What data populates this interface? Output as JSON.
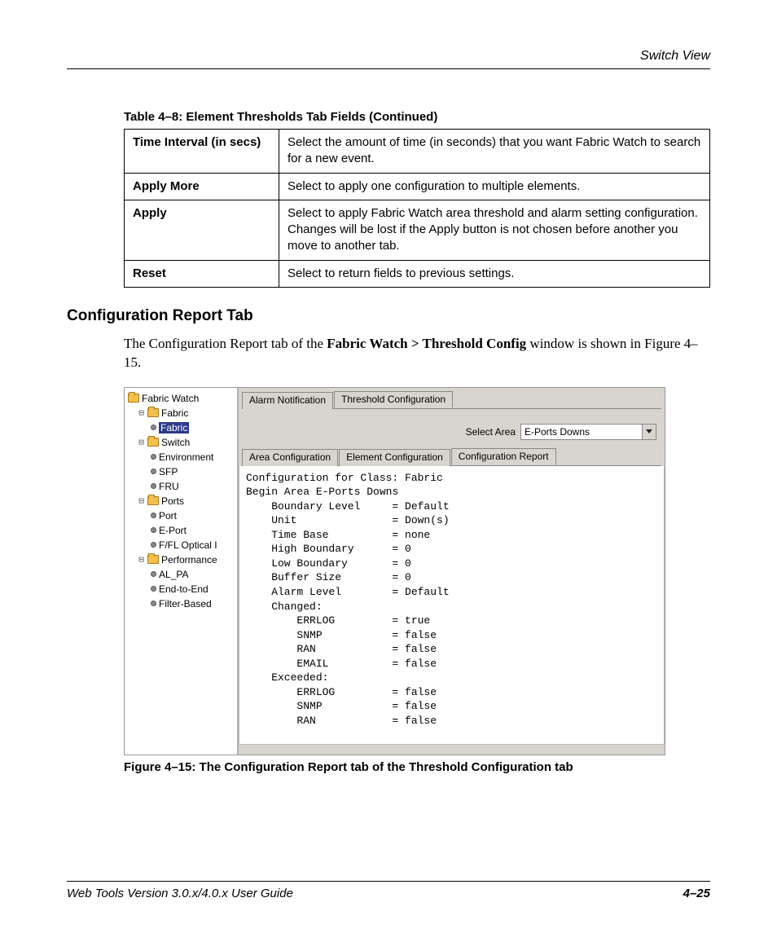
{
  "header": {
    "section": "Switch View"
  },
  "table": {
    "caption": "Table 4–8:  Element Thresholds Tab Fields (Continued)",
    "rows": [
      {
        "field": "Time Interval (in secs)",
        "desc": "Select the amount of time (in seconds) that you want Fabric Watch to search for a new event."
      },
      {
        "field": "Apply More",
        "desc": "Select to apply one configuration to multiple elements."
      },
      {
        "field": "Apply",
        "desc": "Select to apply Fabric Watch area threshold and alarm setting configuration. Changes will be lost if the Apply button is not chosen before another you move to another tab."
      },
      {
        "field": "Reset",
        "desc": "Select to return fields to previous settings."
      }
    ]
  },
  "section_heading": "Configuration Report Tab",
  "paragraph": {
    "pre": "The Configuration Report tab of the ",
    "bold": "Fabric Watch > Threshold Config",
    "post": " window is shown in Figure 4–15."
  },
  "figure": {
    "tree": {
      "root": "Fabric Watch",
      "groups": [
        {
          "label": "Fabric",
          "items": [
            "Fabric"
          ]
        },
        {
          "label": "Switch",
          "items": [
            "Environment",
            "SFP",
            "FRU"
          ]
        },
        {
          "label": "Ports",
          "items": [
            "Port",
            "E-Port",
            "F/FL Optical I"
          ]
        },
        {
          "label": "Performance",
          "items": [
            "AL_PA",
            "End-to-End",
            "Filter-Based"
          ]
        }
      ],
      "selected": "Fabric"
    },
    "tabs_top": {
      "inactive": "Alarm Notification",
      "active": "Threshold Configuration"
    },
    "select_area": {
      "label": "Select Area",
      "value": "E-Ports Downs"
    },
    "tabs_sub": {
      "a": "Area Configuration",
      "b": "Element Configuration",
      "c": "Configuration Report"
    },
    "report_lines": [
      "Configuration for Class: Fabric",
      "Begin Area E-Ports Downs",
      "    Boundary Level     = Default",
      "    Unit               = Down(s)",
      "    Time Base          = none",
      "    High Boundary      = 0",
      "    Low Boundary       = 0",
      "    Buffer Size        = 0",
      "    Alarm Level        = Default",
      "    Changed:",
      "        ERRLOG         = true",
      "        SNMP           = false",
      "        RAN            = false",
      "        EMAIL          = false",
      "    Exceeded:",
      "        ERRLOG         = false",
      "        SNMP           = false",
      "        RAN            = false"
    ],
    "caption": "Figure 4–15:  The Configuration Report tab of the Threshold Configuration tab"
  },
  "footer": {
    "left": "Web Tools Version 3.0.x/4.0.x User Guide",
    "right": "4–25"
  },
  "chart_data": {
    "type": "table",
    "title": "Configuration for Class: Fabric — Begin Area E-Ports Downs",
    "rows": [
      [
        "Boundary Level",
        "Default"
      ],
      [
        "Unit",
        "Down(s)"
      ],
      [
        "Time Base",
        "none"
      ],
      [
        "High Boundary",
        0
      ],
      [
        "Low Boundary",
        0
      ],
      [
        "Buffer Size",
        0
      ],
      [
        "Alarm Level",
        "Default"
      ],
      [
        "Changed.ERRLOG",
        true
      ],
      [
        "Changed.SNMP",
        false
      ],
      [
        "Changed.RAN",
        false
      ],
      [
        "Changed.EMAIL",
        false
      ],
      [
        "Exceeded.ERRLOG",
        false
      ],
      [
        "Exceeded.SNMP",
        false
      ],
      [
        "Exceeded.RAN",
        false
      ]
    ]
  }
}
